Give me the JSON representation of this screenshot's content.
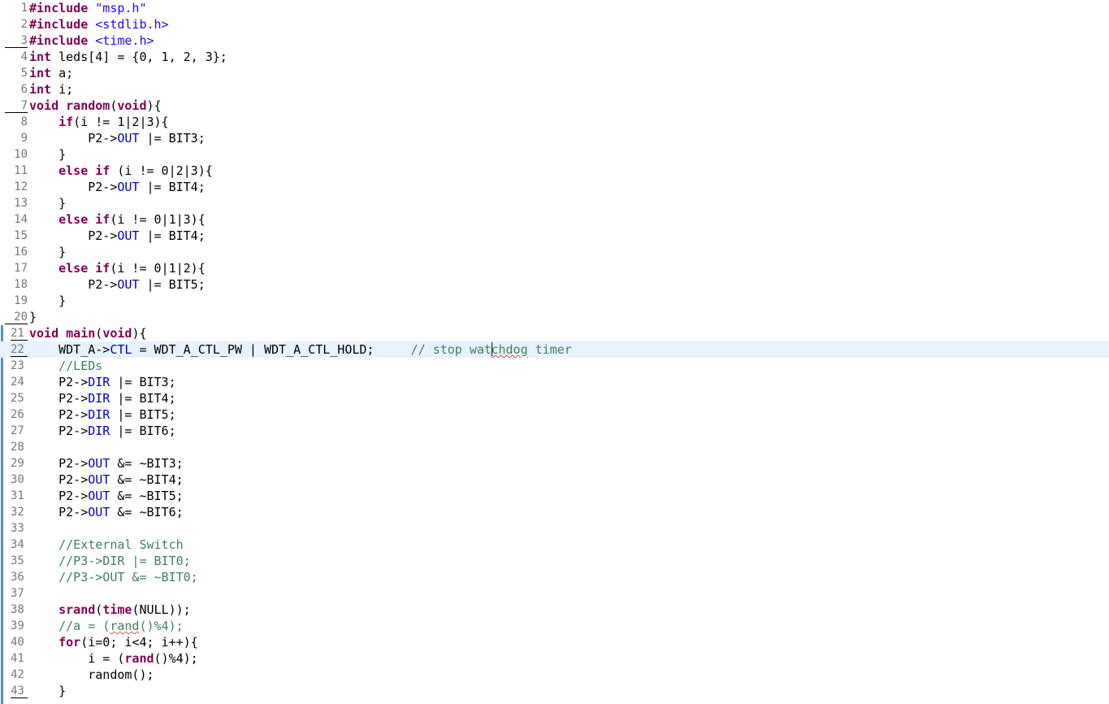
{
  "editor": {
    "current_line": 22,
    "colors": {
      "keyword": "#7f0055",
      "string": "#2a00ff",
      "comment": "#3f7f5f",
      "field": "#0000c0",
      "current_line_bg": "#e8f2fe",
      "change_ruler": "#5b8fc7"
    },
    "lines": [
      {
        "n": "1",
        "t": [
          {
            "k": "kw",
            "s": "#include"
          },
          {
            "s": " "
          },
          {
            "k": "str",
            "s": "\"msp.h\""
          }
        ]
      },
      {
        "n": "2",
        "t": [
          {
            "k": "kw",
            "s": "#include"
          },
          {
            "s": " "
          },
          {
            "k": "str",
            "s": "<stdlib.h>"
          }
        ]
      },
      {
        "n": "3",
        "t": [
          {
            "k": "kw",
            "s": "#include"
          },
          {
            "s": " "
          },
          {
            "k": "str",
            "s": "<time.h>"
          }
        ]
      },
      {
        "n": "4",
        "t": [
          {
            "k": "kw",
            "s": "int"
          },
          {
            "s": " leds[4] = {0, 1, 2, 3};"
          }
        ]
      },
      {
        "n": "5",
        "t": [
          {
            "k": "kw",
            "s": "int"
          },
          {
            "s": " a;"
          }
        ]
      },
      {
        "n": "6",
        "t": [
          {
            "k": "kw",
            "s": "int"
          },
          {
            "s": " i;"
          }
        ]
      },
      {
        "n": "7",
        "t": [
          {
            "k": "kw",
            "s": "void"
          },
          {
            "s": " "
          },
          {
            "k": "kw",
            "s": "random"
          },
          {
            "s": "("
          },
          {
            "k": "kw",
            "s": "void"
          },
          {
            "s": "){"
          }
        ]
      },
      {
        "n": "8",
        "t": [
          {
            "s": "    "
          },
          {
            "k": "kw",
            "s": "if"
          },
          {
            "s": "(i != 1|2|3){"
          }
        ]
      },
      {
        "n": "9",
        "t": [
          {
            "s": "        P2->"
          },
          {
            "k": "fld",
            "s": "OUT"
          },
          {
            "s": " |= BIT3;"
          }
        ]
      },
      {
        "n": "10",
        "t": [
          {
            "s": "    }"
          }
        ]
      },
      {
        "n": "11",
        "t": [
          {
            "s": "    "
          },
          {
            "k": "kw",
            "s": "else"
          },
          {
            "s": " "
          },
          {
            "k": "kw",
            "s": "if"
          },
          {
            "s": " (i != 0|2|3){"
          }
        ]
      },
      {
        "n": "12",
        "t": [
          {
            "s": "        P2->"
          },
          {
            "k": "fld",
            "s": "OUT"
          },
          {
            "s": " |= BIT4;"
          }
        ]
      },
      {
        "n": "13",
        "t": [
          {
            "s": "    }"
          }
        ]
      },
      {
        "n": "14",
        "t": [
          {
            "s": "    "
          },
          {
            "k": "kw",
            "s": "else"
          },
          {
            "s": " "
          },
          {
            "k": "kw",
            "s": "if"
          },
          {
            "s": "(i != 0|1|3){"
          }
        ]
      },
      {
        "n": "15",
        "t": [
          {
            "s": "        P2->"
          },
          {
            "k": "fld",
            "s": "OUT"
          },
          {
            "s": " |= BIT4;"
          }
        ]
      },
      {
        "n": "16",
        "t": [
          {
            "s": "    }"
          }
        ]
      },
      {
        "n": "17",
        "t": [
          {
            "s": "    "
          },
          {
            "k": "kw",
            "s": "else"
          },
          {
            "s": " "
          },
          {
            "k": "kw",
            "s": "if"
          },
          {
            "s": "(i != 0|1|2){"
          }
        ]
      },
      {
        "n": "18",
        "t": [
          {
            "s": "        P2->"
          },
          {
            "k": "fld",
            "s": "OUT"
          },
          {
            "s": " |= BIT5;"
          }
        ]
      },
      {
        "n": "19",
        "t": [
          {
            "s": "    }"
          }
        ]
      },
      {
        "n": "20",
        "t": [
          {
            "s": "}"
          }
        ]
      },
      {
        "n": "21",
        "t": [
          {
            "k": "kw",
            "s": "void"
          },
          {
            "s": " "
          },
          {
            "k": "kw",
            "s": "main"
          },
          {
            "s": "("
          },
          {
            "k": "kw",
            "s": "void"
          },
          {
            "s": "){"
          }
        ]
      },
      {
        "n": "22",
        "t": [
          {
            "s": "    WDT_A->"
          },
          {
            "k": "fld",
            "s": "CTL"
          },
          {
            "s": " = WDT_A_CTL_PW | WDT_A_CTL_HOLD;     "
          },
          {
            "k": "cm",
            "s": "// stop wat"
          },
          {
            "k": "caret",
            "s": ""
          },
          {
            "k": "cm typo",
            "s": "chdog"
          },
          {
            "k": "cm",
            "s": " timer"
          }
        ]
      },
      {
        "n": "23",
        "t": [
          {
            "s": "    "
          },
          {
            "k": "cm",
            "s": "//LEDs"
          }
        ]
      },
      {
        "n": "24",
        "t": [
          {
            "s": "    P2->"
          },
          {
            "k": "fld",
            "s": "DIR"
          },
          {
            "s": " |= BIT3;"
          }
        ]
      },
      {
        "n": "25",
        "t": [
          {
            "s": "    P2->"
          },
          {
            "k": "fld",
            "s": "DIR"
          },
          {
            "s": " |= BIT4;"
          }
        ]
      },
      {
        "n": "26",
        "t": [
          {
            "s": "    P2->"
          },
          {
            "k": "fld",
            "s": "DIR"
          },
          {
            "s": " |= BIT5;"
          }
        ]
      },
      {
        "n": "27",
        "t": [
          {
            "s": "    P2->"
          },
          {
            "k": "fld",
            "s": "DIR"
          },
          {
            "s": " |= BIT6;"
          }
        ]
      },
      {
        "n": "28",
        "t": []
      },
      {
        "n": "29",
        "t": [
          {
            "s": "    P2->"
          },
          {
            "k": "fld",
            "s": "OUT"
          },
          {
            "s": " &= ~BIT3;"
          }
        ]
      },
      {
        "n": "30",
        "t": [
          {
            "s": "    P2->"
          },
          {
            "k": "fld",
            "s": "OUT"
          },
          {
            "s": " &= ~BIT4;"
          }
        ]
      },
      {
        "n": "31",
        "t": [
          {
            "s": "    P2->"
          },
          {
            "k": "fld",
            "s": "OUT"
          },
          {
            "s": " &= ~BIT5;"
          }
        ]
      },
      {
        "n": "32",
        "t": [
          {
            "s": "    P2->"
          },
          {
            "k": "fld",
            "s": "OUT"
          },
          {
            "s": " &= ~BIT6;"
          }
        ]
      },
      {
        "n": "33",
        "t": []
      },
      {
        "n": "34",
        "t": [
          {
            "s": "    "
          },
          {
            "k": "cm",
            "s": "//External Switch"
          }
        ]
      },
      {
        "n": "35",
        "t": [
          {
            "s": "    "
          },
          {
            "k": "cm",
            "s": "//P3->DIR |= BIT0;"
          }
        ]
      },
      {
        "n": "36",
        "t": [
          {
            "s": "    "
          },
          {
            "k": "cm",
            "s": "//P3->OUT &= ~BIT0;"
          }
        ]
      },
      {
        "n": "37",
        "t": []
      },
      {
        "n": "38",
        "t": [
          {
            "s": "    "
          },
          {
            "k": "kw",
            "s": "srand"
          },
          {
            "s": "("
          },
          {
            "k": "kw",
            "s": "time"
          },
          {
            "s": "(NULL));"
          }
        ]
      },
      {
        "n": "39",
        "t": [
          {
            "s": "    "
          },
          {
            "k": "cm",
            "s": "//a = ("
          },
          {
            "k": "cm typo",
            "s": "rand"
          },
          {
            "k": "cm",
            "s": "()%4);"
          }
        ]
      },
      {
        "n": "40",
        "t": [
          {
            "s": "    "
          },
          {
            "k": "kw",
            "s": "for"
          },
          {
            "s": "(i=0; i<4; i++){"
          }
        ]
      },
      {
        "n": "41",
        "t": [
          {
            "s": "        i = ("
          },
          {
            "k": "kw",
            "s": "rand"
          },
          {
            "s": "()%4);"
          }
        ]
      },
      {
        "n": "42",
        "t": [
          {
            "s": "        random();"
          }
        ]
      },
      {
        "n": "43",
        "t": [
          {
            "s": "    }"
          }
        ]
      }
    ]
  }
}
